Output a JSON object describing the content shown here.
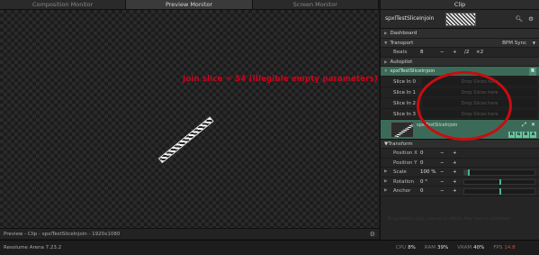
{
  "monitor_tabs": [
    "Composition Monitor",
    "Preview Monitor",
    "Screen Monitor"
  ],
  "annotation": "Join slice = 54 (illegible empty parameters)",
  "preview_status": "Preview - Clip - spxlTestSliceInjoin - 1920x1080",
  "app_name": "Resolume Arena 7.23.2",
  "stats": {
    "cpu_label": "CPU",
    "cpu": "8%",
    "ram_label": "RAM",
    "ram": "39%",
    "vram_label": "VRAM",
    "vram": "40%",
    "fps_label": "FPS",
    "fps": "14.8"
  },
  "panel": {
    "title": "Clip",
    "clip_name": "spxlTestSliceInjoin",
    "dashboard": "Dashboard",
    "transport": "Transport",
    "bpm_sync": "BPM Sync",
    "beats_label": "Beats",
    "beats_value": "8",
    "minus": "−",
    "plus": "+",
    "div2": "/2",
    "mul2": "×2",
    "autopilot": "Autopilot",
    "effect_section": "spxlTestSliceInjoin",
    "r": "R",
    "slices": [
      {
        "label": "Slice In 0",
        "drop": "Drop Slices here"
      },
      {
        "label": "Slice In 1",
        "drop": "Drop Slices here"
      },
      {
        "label": "Slice In 2",
        "drop": "Drop Slices here"
      },
      {
        "label": "Slice In 3",
        "drop": "Drop Slices here"
      }
    ],
    "effect_name": "spxlTestSliceInjoin",
    "rgba": [
      "R",
      "G",
      "B",
      "A"
    ],
    "transform": "Transform",
    "position_x_label": "Position X",
    "position_x": "0",
    "position_y_label": "Position Y",
    "position_y": "0",
    "scale_label": "Scale",
    "scale": "100 %",
    "rotation_label": "Rotation",
    "rotation": "0 °",
    "anchor_label": "Anchor",
    "anchor": "0",
    "ghost_hint": "Drag effects, clips, sources or effects files here to add them"
  },
  "colors": {
    "accent_green": "#3b6b58",
    "annotation_red": "#d0021b"
  },
  "values": {
    "scale_fill": 0.05,
    "rotation_knob": 0.5,
    "anchor_knob": 0.5
  }
}
